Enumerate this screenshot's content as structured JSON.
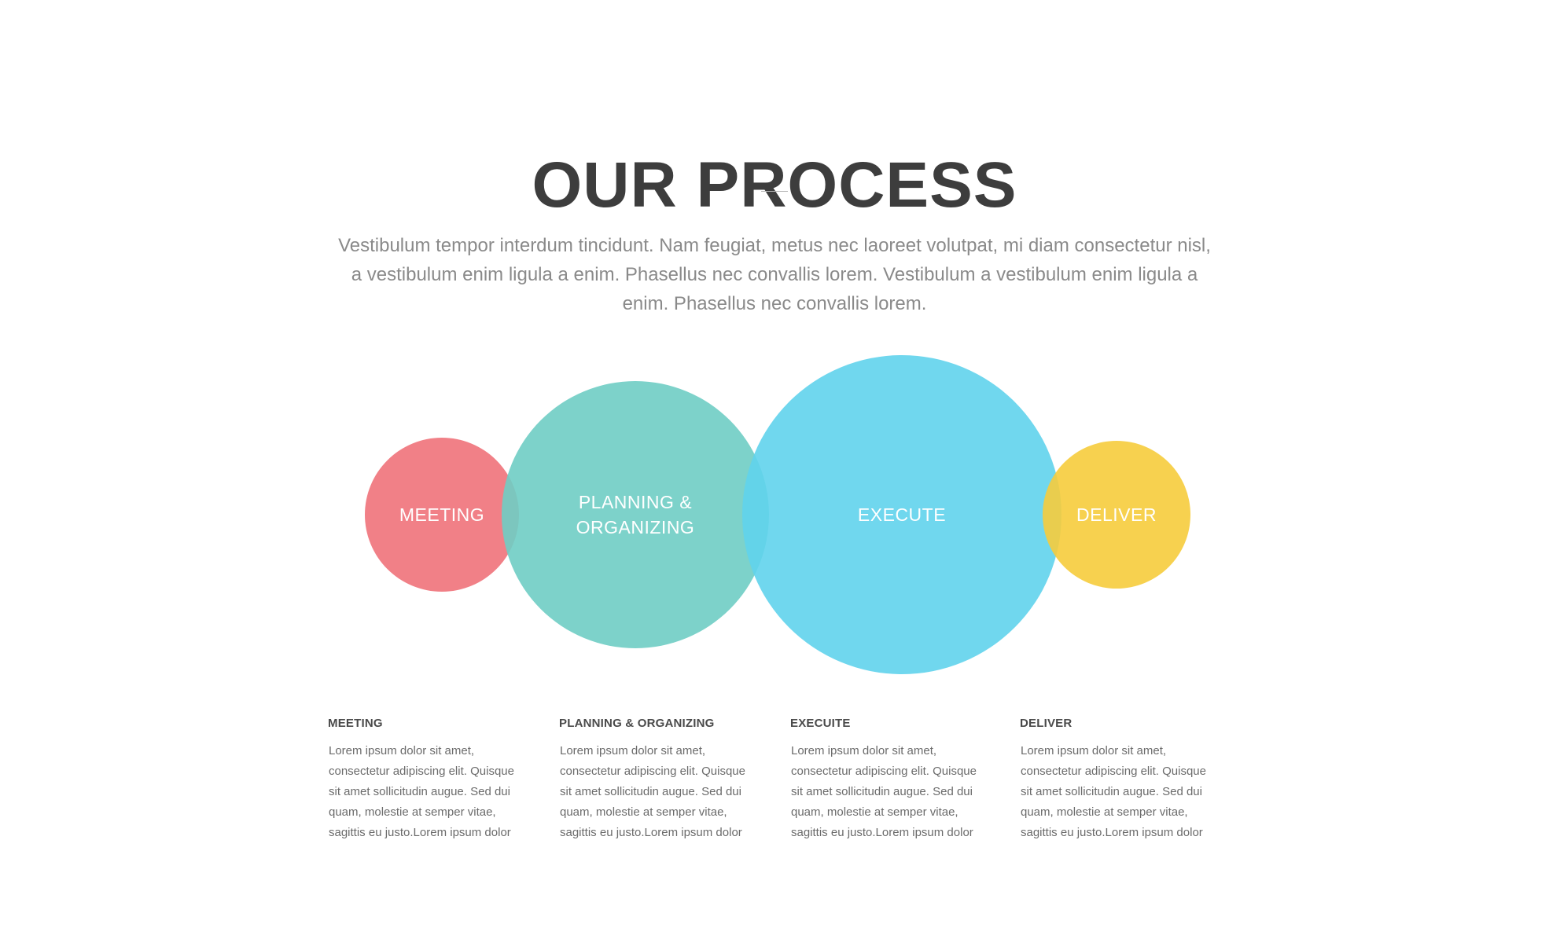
{
  "header": {
    "title": "OUR PROCESS",
    "intro": "Vestibulum tempor interdum tincidunt. Nam feugiat, metus nec laoreet volutpat, mi diam consectetur nisl, a vestibulum enim ligula a enim. Phasellus nec convallis lorem. Vestibulum a vestibulum enim ligula a enim. Phasellus nec convallis lorem."
  },
  "diagram": {
    "circles": [
      {
        "label_lines": [
          "MEETING"
        ],
        "color": "#f0727a"
      },
      {
        "label_lines": [
          "PLANNING &",
          "ORGANIZING"
        ],
        "color": "#6fcdc4"
      },
      {
        "label_lines": [
          "EXECUTE"
        ],
        "color": "#60d3ec"
      },
      {
        "label_lines": [
          "DELIVER"
        ],
        "color": "#f6cc3c"
      }
    ]
  },
  "steps": [
    {
      "title": "MEETING",
      "text": "Lorem ipsum dolor sit amet, consectetur adipiscing elit. Quisque sit amet sollicitudin augue. Sed dui quam, molestie at semper vitae, sagittis eu justo.Lorem ipsum dolor"
    },
    {
      "title": "PLANNING & ORGANIZING",
      "text": "Lorem ipsum dolor sit amet, consectetur adipiscing elit. Quisque sit amet sollicitudin augue. Sed dui quam, molestie at semper vitae, sagittis eu justo.Lorem ipsum dolor"
    },
    {
      "title": "EXECUITE",
      "text": "Lorem ipsum dolor sit amet, consectetur adipiscing elit. Quisque sit amet sollicitudin augue. Sed dui quam, molestie at semper vitae, sagittis eu justo.Lorem ipsum dolor"
    },
    {
      "title": "DELIVER",
      "text": "Lorem ipsum dolor sit amet, consectetur adipiscing elit. Quisque sit amet sollicitudin augue. Sed dui quam, molestie at semper vitae, sagittis eu justo.Lorem ipsum dolor"
    }
  ]
}
